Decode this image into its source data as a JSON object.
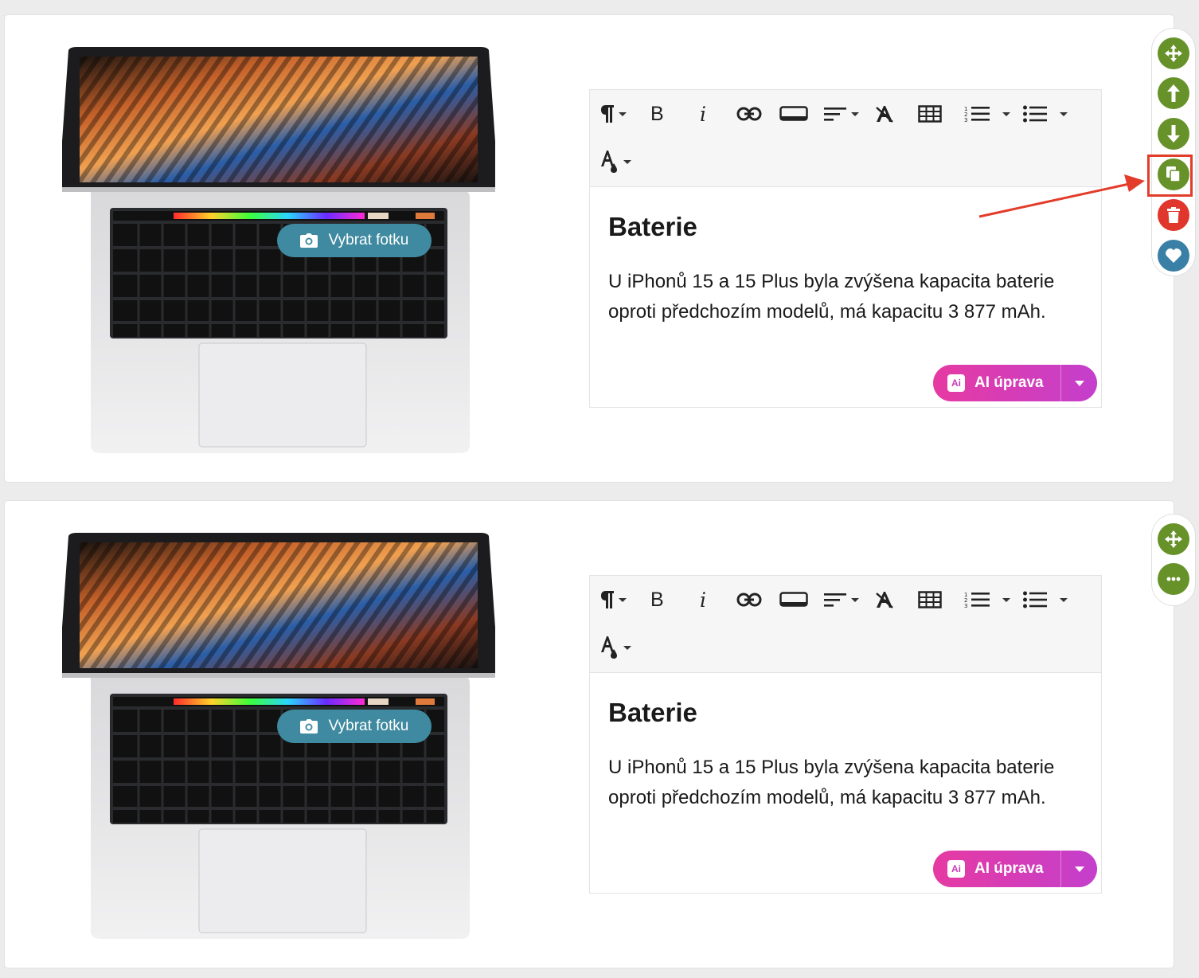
{
  "blocks": [
    {
      "photo_button_label": "Vybrat fotku",
      "heading": "Baterie",
      "paragraph": "U iPhonů 15 a 15 Plus byla zvýšena kapacita baterie oproti předchozím modelů, má kapacitu 3 877 mAh.",
      "ai_button_label": "AI úprava",
      "ai_badge": "Ai",
      "laptop_model": "MacBook Pro"
    },
    {
      "photo_button_label": "Vybrat fotku",
      "heading": "Baterie",
      "paragraph": "U iPhonů 15 a 15 Plus byla zvýšena kapacita baterie oproti předchozím modelů, má kapacitu 3 877 mAh.",
      "ai_button_label": "AI úprava",
      "ai_badge": "Ai",
      "laptop_model": "MacBook Pro"
    }
  ],
  "toolbar": {
    "items": [
      "paragraph-format",
      "bold",
      "italic",
      "link",
      "button",
      "align",
      "clear-format",
      "table",
      "ordered-list",
      "unordered-list",
      "text-color"
    ],
    "bold_glyph": "B",
    "italic_glyph": "i"
  },
  "rail_top": [
    "move-icon",
    "arrow-up-icon",
    "arrow-down-icon",
    "duplicate-icon",
    "trash-icon",
    "heart-icon"
  ],
  "rail_bottom": [
    "move-icon",
    "more-icon"
  ],
  "colors": {
    "green": "#67922a",
    "red": "#e0362c",
    "blue": "#3a7fa5",
    "photo_button": "#3f8aa0",
    "ai_start": "#e63aa2",
    "ai_end": "#c43fcc",
    "annotation": "#e33c2a"
  }
}
